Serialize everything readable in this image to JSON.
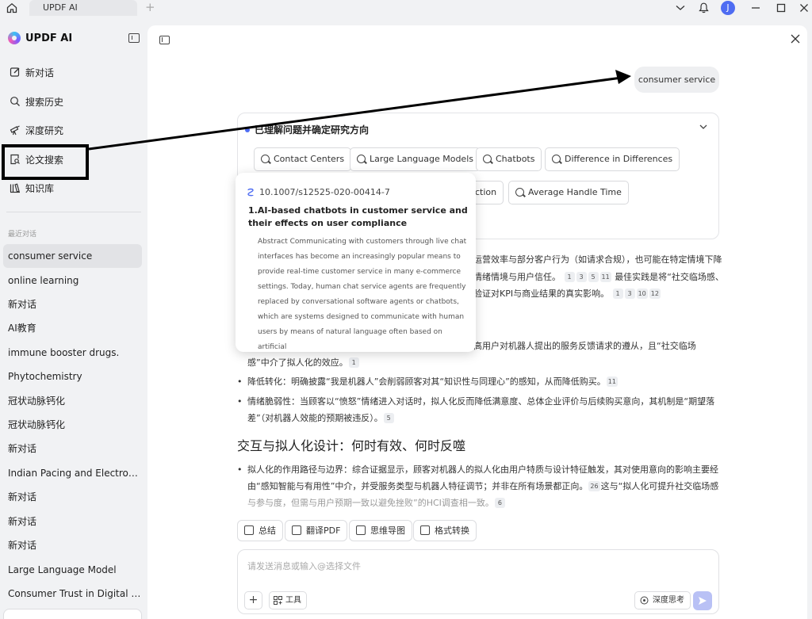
{
  "titlebar": {
    "tab_label": "UPDF AI",
    "tab_add": "+",
    "avatar_letter": "J"
  },
  "sidebar": {
    "brand": "UPDF AI",
    "nav": [
      {
        "label": "新对话",
        "icon": "edit-icon"
      },
      {
        "label": "搜索历史",
        "icon": "search-icon"
      },
      {
        "label": "深度研究",
        "icon": "telescope-icon"
      },
      {
        "label": "论文搜索",
        "icon": "paper-search-icon"
      },
      {
        "label": "知识库",
        "icon": "library-icon"
      }
    ],
    "recent_label": "最近对话",
    "history": [
      "consumer service",
      "online learning",
      "新对话",
      "AI教育",
      "immune booster drugs.",
      "Phytochemistry",
      "冠状动脉钙化",
      "冠状动脉钙化",
      "新对话",
      "Indian Pacing and Electrophysiology",
      "新对话",
      "新对话",
      "新对话",
      "Large Language Model",
      "Consumer Trust in Digital Marketing"
    ]
  },
  "chat": {
    "user_message": "consumer service",
    "research": {
      "title": "已理解问题并确定研究方向",
      "chips_row1": [
        "Contact Centers",
        "Large Language Models",
        "Chatbots",
        "Difference in Differences"
      ],
      "chip_partial": "ction",
      "chip_row2_last": "Average Handle Time"
    },
    "para1": {
      "l1": "运营效率与部分客户行为（如请求合规），也可能在特定情境下降",
      "l2": "情绪情境与用户信任。",
      "l2_cites": [
        "1",
        "3",
        "5",
        "11"
      ],
      "l2_tail": "最佳实践是将“社交临场感、",
      "l3": "验证对KPI与商业结果的真实影响。",
      "l3_cites": [
        "1",
        "3",
        "10",
        "12"
      ]
    },
    "bullet1": {
      "l1": "高用户对机器人提出的服务反馈请求的遵从，且“社交临场",
      "l2": "感”中介了拟人化的效应。",
      "cite": "1"
    },
    "bullet2": {
      "text": "降低转化：明确披露“我是机器人”会削弱顾客对其“知识性与同理心”的感知，从而降低购买。",
      "cite": "11"
    },
    "bullet3": {
      "l1": "情绪脆弱性：当顾客以“愤怒”情绪进入对话时，拟人化反而降低满意度、总体企业评价与后续购买意向，其机制是“期望落",
      "l2": "差”（对机器人效能的预期被违反）。",
      "cite": "5"
    },
    "heading": "交互与拟人化设计：何时有效、何时反噬",
    "bullet4": {
      "l1": "拟人化的作用路径与边界：综合证据显示，顾客对机器人的拟人化由用户特质与设计特征触发，其对使用意向的影响主要经",
      "l2": "由“感知智能与有用性”中介，并受服务类型与机器人特征调节；并非在所有场景都正向。",
      "l2_cite": "26",
      "l2_tail": "这与“拟人化可提升社交临场感",
      "l3": "与参与度，但需与用户预期一致以避免挫败”的HCI调查相一致。",
      "l3_cite": "6"
    }
  },
  "popover": {
    "doi": "10.1007/s12525-020-00414-7",
    "title": "1.AI-based chatbots in customer service and their effects on user compliance",
    "abstract": "Abstract Communicating with customers through live chat interfaces has become an increasingly popular means to provide real-time customer service in many e-commerce settings. Today, human chat service agents are frequently replaced by conversational software agents or chatbots, which are systems designed to communicate with human users by means of natural language often based on artificial"
  },
  "actions": [
    "总结",
    "翻译PDF",
    "思维导图",
    "格式转换"
  ],
  "composer": {
    "placeholder": "请发送消息或输入@选择文件",
    "plus": "+",
    "tools": "工具",
    "deep_think": "深度思考"
  },
  "colors": {
    "accent": "#4e6cf2",
    "send_disabled": "#b9c1f5",
    "sidebar_bg": "#f1f2f4"
  }
}
